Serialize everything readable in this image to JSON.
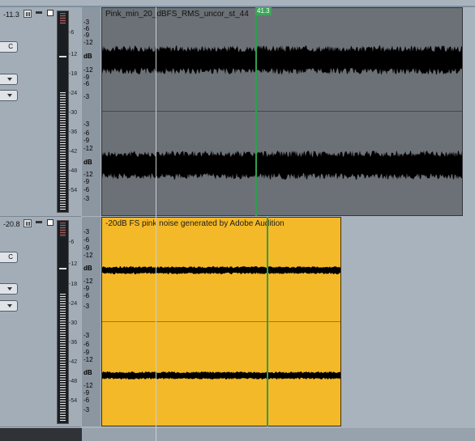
{
  "tracks": [
    {
      "volume": "-11.3",
      "c_label": "C",
      "meter_labels": [
        "-6",
        "-12",
        "-18",
        "-24",
        "-30",
        "-36",
        "-42",
        "-48",
        "-54"
      ],
      "ruler_labels_top": [
        "-3",
        "-6",
        "-9",
        "-12",
        "dB",
        "-12",
        "-9",
        "-6",
        "-3"
      ],
      "ruler_labels_bottom": [
        "-3",
        "-6",
        "-9",
        "-12",
        "dB",
        "-12",
        "-9",
        "-6",
        "-3"
      ],
      "clip_title": "Pink_min_20_dBFS_RMS_uncor_st_44",
      "clip_color": "#6c7177"
    },
    {
      "volume": "-20.8",
      "c_label": "C",
      "meter_labels": [
        "-6",
        "-12",
        "-18",
        "-24",
        "-30",
        "-36",
        "-42",
        "-48",
        "-54"
      ],
      "ruler_labels_top": [
        "-3",
        "-6",
        "-9",
        "-12",
        "dB",
        "-12",
        "-9",
        "-6",
        "-3"
      ],
      "ruler_labels_bottom": [
        "-3",
        "-6",
        "-9",
        "-12",
        "dB",
        "-12",
        "-9",
        "-6",
        "-3"
      ],
      "clip_title": "-20dB FS pink noise generated by Adobe Audition",
      "clip_color": "#f4b928"
    }
  ],
  "playhead_label": "41.3",
  "colors": {
    "background": "#a9b3be",
    "clip_grey": "#6c7177",
    "clip_yellow": "#f4b928",
    "playhead": "#2e9e4e"
  }
}
